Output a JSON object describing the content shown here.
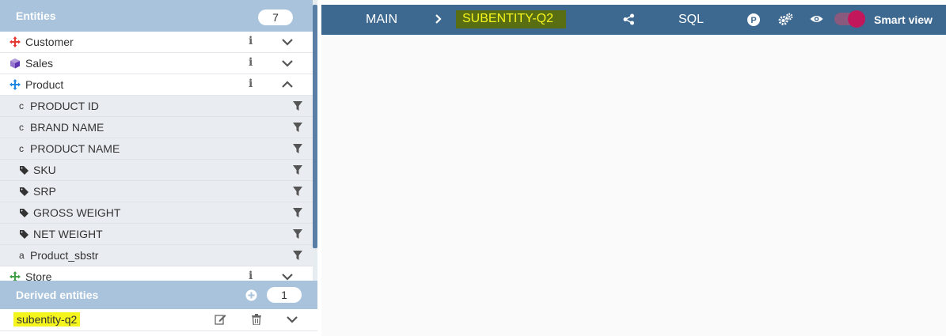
{
  "entities_panel": {
    "title": "Entities",
    "count": "7",
    "items": [
      {
        "label": "Customer",
        "icon": "arrows-move-red-icon",
        "color": "#e53935"
      },
      {
        "label": "Sales",
        "icon": "cube-purple-icon",
        "color": "#7e57c2"
      },
      {
        "label": "Product",
        "icon": "arrows-move-blue-icon",
        "color": "#1e88e5"
      }
    ],
    "product_attributes": [
      {
        "type": "c",
        "label": "PRODUCT ID"
      },
      {
        "type": "c",
        "label": "BRAND NAME"
      },
      {
        "type": "c",
        "label": "PRODUCT NAME"
      },
      {
        "type": "tag",
        "label": "SKU"
      },
      {
        "type": "tag",
        "label": "SRP"
      },
      {
        "type": "tag",
        "label": "GROSS WEIGHT"
      },
      {
        "type": "tag",
        "label": "NET WEIGHT"
      },
      {
        "type": "a",
        "label": "Product_sbstr"
      }
    ],
    "store": {
      "label": "Store",
      "icon": "arrows-move-green-icon",
      "color": "#43a047"
    }
  },
  "derived_panel": {
    "title": "Derived entities",
    "count": "1",
    "items": [
      {
        "name": "subentity-q2"
      }
    ]
  },
  "topbar": {
    "main_label": "MAIN",
    "breadcrumb": "SUBENTITY-Q2",
    "sql_label": "SQL",
    "p_label": "P",
    "smart_view_label": "Smart view"
  },
  "colors": {
    "header_bg": "#a8c3db",
    "topbar_bg": "#3d6890",
    "highlight": "#f5f51e",
    "toggle_knob": "#c2185b"
  }
}
